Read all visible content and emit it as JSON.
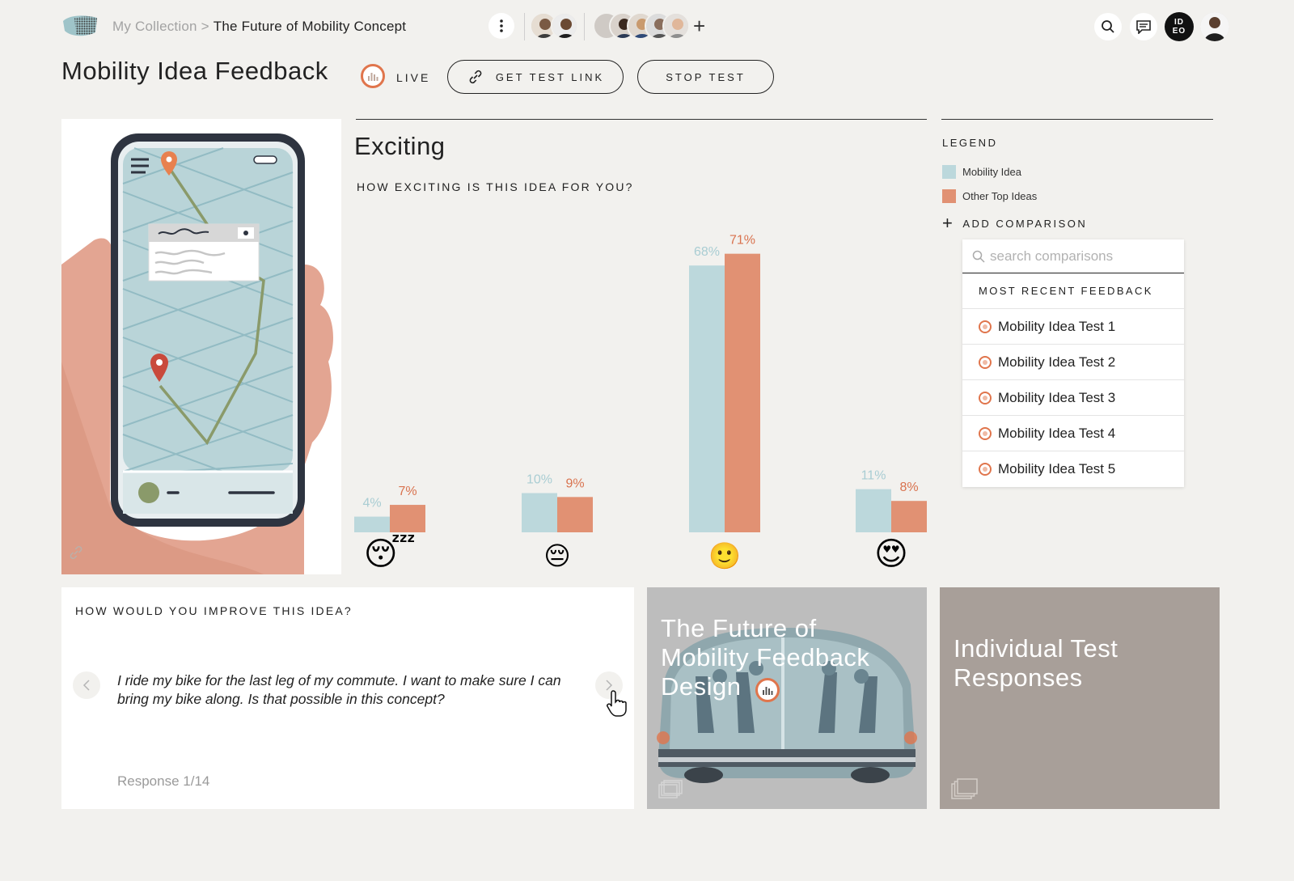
{
  "header": {
    "breadcrumb_root": "My Collection",
    "breadcrumb_sep": ">",
    "breadcrumb_current": "The Future of Mobility Concept",
    "org_badge_line1": "ID",
    "org_badge_line2": "EO",
    "add_label": "+"
  },
  "title_row": {
    "title": "Mobility Idea Feedback",
    "status": "LIVE",
    "get_link": "GET TEST LINK",
    "stop_test": "STOP TEST"
  },
  "chart_data": {
    "type": "bar",
    "title": "Exciting",
    "question": "HOW EXCITING IS THIS IDEA FOR YOU?",
    "categories": [
      "sleepy",
      "disappointed",
      "slightly-smiling",
      "heart-eyes"
    ],
    "category_icons": [
      "😴",
      "😔",
      "🙂",
      "😍"
    ],
    "series": [
      {
        "name": "Mobility Idea",
        "values": [
          4,
          10,
          68,
          11
        ],
        "color": "#bcd8dc"
      },
      {
        "name": "Other Top Ideas",
        "values": [
          7,
          9,
          71,
          8
        ],
        "color": "#e19173"
      }
    ],
    "value_suffix": "%",
    "ylim": [
      0,
      100
    ]
  },
  "legend": {
    "title": "LEGEND",
    "items": [
      {
        "label": "Mobility Idea",
        "color": "#bcd8dc"
      },
      {
        "label": "Other Top Ideas",
        "color": "#e19173"
      }
    ],
    "add_comparison": "ADD COMPARISON"
  },
  "comparisons": {
    "search_placeholder": "search comparisons",
    "section_title": "MOST RECENT FEEDBACK",
    "items": [
      "Mobility Idea Test 1",
      "Mobility Idea Test 2",
      "Mobility Idea Test 3",
      "Mobility Idea Test 4",
      "Mobility Idea Test 5"
    ]
  },
  "improve": {
    "question": "HOW WOULD YOU IMPROVE THIS IDEA?",
    "response": "I ride my bike for the last leg of my commute. I want to make sure I can bring my bike along. Is that possible in this concept?",
    "count": "Response 1/14"
  },
  "tiles": {
    "design_title": "The Future of Mobility Feedback Design",
    "responses_title": "Individual Test Responses"
  },
  "colors": {
    "accent": "#e0754c",
    "mobility": "#bcd8dc",
    "other": "#e19173",
    "tile_design_bg": "#bdbdbd",
    "tile_responses_bg": "#a89f99"
  }
}
